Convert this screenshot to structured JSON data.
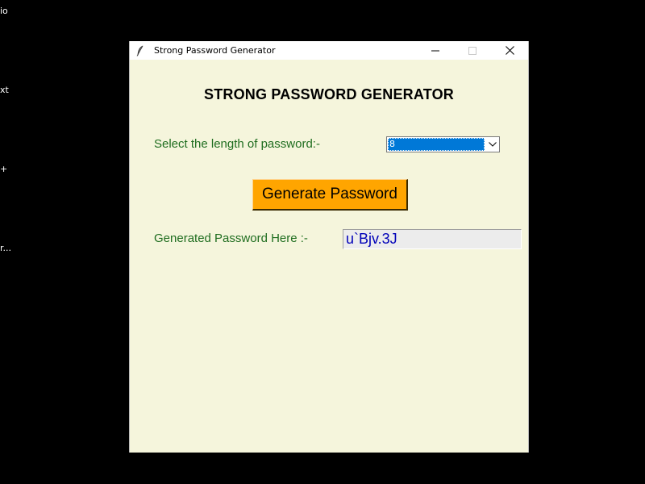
{
  "desktop": {
    "labels": [
      "io",
      "xt",
      "+",
      "r..."
    ]
  },
  "window": {
    "title": "Strong Password Generator",
    "controls": {
      "minimize": "minimize-icon",
      "maximize": "maximize-icon",
      "close": "close-icon"
    }
  },
  "app": {
    "heading": "STRONG PASSWORD GENERATOR",
    "length_label": "Select the length of password:-",
    "length_value": "8",
    "generate_label": "Generate Password",
    "output_label": "Generated Password Here :-",
    "output_value": "u`Bjv.3J"
  },
  "colors": {
    "window_bg": "#f5f5dc",
    "label_green": "#1f6d1f",
    "button_orange": "#ffa500",
    "password_blue": "#0000b8",
    "selection_blue": "#0078d7"
  }
}
